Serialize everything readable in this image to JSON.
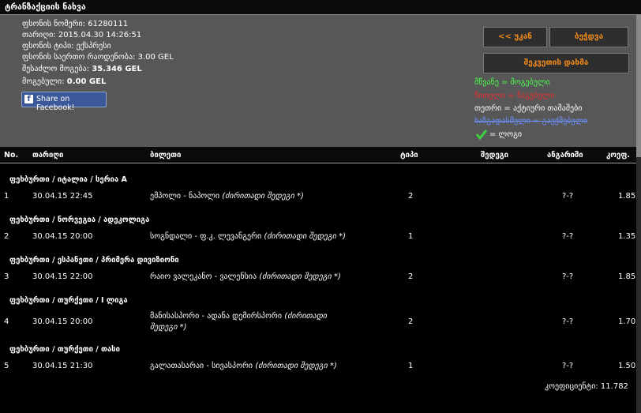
{
  "window": {
    "title": "ტრანზაქციის ნახვა"
  },
  "info": {
    "ticket_number_label": "ფსონის ნომერი:",
    "ticket_number": "61280111",
    "date_label": "თარიღი:",
    "date": "2015.04.30 14:26:51",
    "type_label": "ფსონის ტიპი:",
    "type": "ექსპრესი",
    "total_label": "ფსონის საერთო რაოდენობა:",
    "total": "3.00 GEL",
    "possible_label": "შესაძლო მოგება:",
    "possible": "35.346 GEL",
    "win_label": "მოგებული:",
    "win": "0.00 GEL",
    "facebook_label": "Share on Facebook!"
  },
  "buttons": {
    "back": "<< უკან",
    "print": "ბეჭდვა",
    "close_order": "შეკვეთის დახმა"
  },
  "legend": {
    "green": "მწვანე = მოგებული",
    "red": "წითელი = წაგებული",
    "white": "თეთრი = აქტიური თამაშები",
    "blue": "ხაზგადასმული = გაუქმებული",
    "check": "= ლოგი"
  },
  "colors": {
    "background": "#000000",
    "panel": "#575757",
    "accent": "#f08a1a",
    "green": "#4aff4a",
    "red": "#e83030",
    "blue": "#6b8fff"
  },
  "table": {
    "headers": [
      "No.",
      "თარიღი",
      "ბილეთი",
      "ტიპი",
      "შედეგი",
      "ანგარიში",
      "კოეფ."
    ],
    "rows": [
      {
        "section": "ფეხბურთი / იტალია / სერია A",
        "no": "1",
        "date": "30.04.15 22:45",
        "match": "ემპოლი - ნაპოლი",
        "market": "(ძირითადი შედეგი *)",
        "type": "2",
        "result": "",
        "score": "?-?",
        "coef": "1.85"
      },
      {
        "section": "ფეხბურთი / ნორვეგია / ადეკოლიგა",
        "no": "2",
        "date": "30.04.15 20:00",
        "match": "სოგნდალი - ფ.კ. ლევანგერი",
        "market": "(ძირითადი შედეგი *)",
        "type": "1",
        "result": "",
        "score": "?-?",
        "coef": "1.35"
      },
      {
        "section": "ფეხბურთი / ესპანეთი / პრიმერა დივიზიონი",
        "no": "3",
        "date": "30.04.15 22:00",
        "match": "რაიო ვალეკანო - ვალენსია",
        "market": "(ძირითადი შედეგი *)",
        "type": "2",
        "result": "",
        "score": "?-?",
        "coef": "1.85"
      },
      {
        "section": "ფეხბურთი / თურქეთი / I ლიგა",
        "no": "4",
        "date": "30.04.15 20:00",
        "match": "მანისასპორი - ადანა დემირსპორი",
        "market": "(ძირითადი შედეგი *)",
        "type": "2",
        "result": "",
        "score": "?-?",
        "coef": "1.70"
      },
      {
        "section": "ფეხბურთი / თურქეთი / თასი",
        "no": "5",
        "date": "30.04.15 21:30",
        "match": "გალათასარაი - სივასპორი",
        "market": "(ძირითადი შედეგი *)",
        "type": "1",
        "result": "",
        "score": "?-?",
        "coef": "1.50"
      }
    ]
  },
  "total_coef": "კოეფიციენტი: 11.782"
}
